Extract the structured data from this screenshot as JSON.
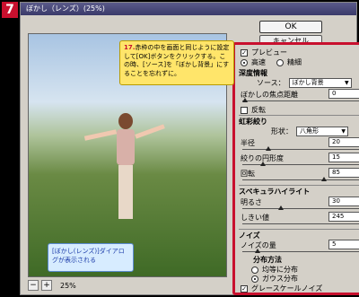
{
  "step_number": "7",
  "window": {
    "title": "ぼかし（レンズ）(25%)"
  },
  "buttons": {
    "ok": "OK",
    "cancel": "キャンセル"
  },
  "zoom": {
    "minus": "−",
    "plus": "+",
    "label": "25%"
  },
  "panel": {
    "preview_label": "プレビュー",
    "preview_checked": true,
    "speed": {
      "fast": "高速",
      "accurate": "精細",
      "selected": "fast"
    },
    "depth": {
      "title": "深度情報",
      "source_label": "ソース：",
      "source_value": "ぼかし背景",
      "focus_label": "ぼかしの焦点距離",
      "focus_value": "0",
      "invert_label": "反転"
    },
    "iris": {
      "title": "虹彩絞り",
      "shape_label": "形状：",
      "shape_value": "八角形",
      "radius_label": "半径",
      "radius_value": "20",
      "curvature_label": "絞りの円形度",
      "curvature_value": "15",
      "rotation_label": "回転",
      "rotation_value": "85"
    },
    "specular": {
      "title": "スペキュラハイライト",
      "brightness_label": "明るさ",
      "brightness_value": "30",
      "threshold_label": "しきい値",
      "threshold_value": "245"
    },
    "noise": {
      "title": "ノイズ",
      "amount_label": "ノイズの量",
      "amount_value": "5",
      "dist_title": "分布方法",
      "uniform": "均等に分布",
      "gaussian": "ガウス分布",
      "selected": "gaussian"
    },
    "mono_label": "グレースケールノイズ",
    "mono_checked": true
  },
  "callouts": {
    "main_num": "17.",
    "main_text": "赤枠の中を画面と同じように設定して[OK]ボタンをクリックする。この時、[ソース]を「ぼかし背景」にすることを忘れずに。",
    "sub_text": "[ぼかし(レンズ)]ダイアログが表示される"
  },
  "colors": {
    "accent": "#c8102e",
    "note_yellow": "#ffe56a",
    "note_blue": "#d7ecff"
  }
}
